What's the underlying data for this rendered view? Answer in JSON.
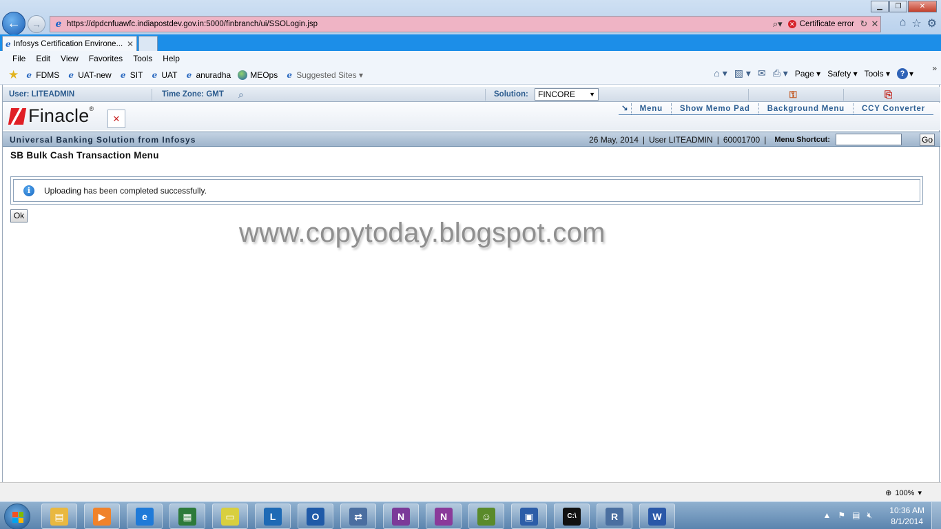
{
  "browser": {
    "url": "https://dpdcnfuawfc.indiapostdev.gov.in:5000/finbranch/ui/SSOLogin.jsp",
    "certificate_error": "Certificate error",
    "tab_title": "Infosys Certification Environe...",
    "menu": [
      "File",
      "Edit",
      "View",
      "Favorites",
      "Tools",
      "Help"
    ],
    "favorites": [
      "FDMS",
      "UAT-new",
      "SIT",
      "UAT",
      "anuradha",
      "MEOps",
      "Suggested Sites"
    ],
    "command_bar": {
      "page": "Page",
      "safety": "Safety",
      "tools": "Tools"
    },
    "zoom": "100%"
  },
  "app": {
    "user_label": "User: LITEADMIN",
    "timezone_label": "Time Zone:  GMT",
    "solution_label": "Solution:",
    "solution_value": "FINCORE",
    "logo_text": "Finacle",
    "logo_mark": "®",
    "top_menu": [
      "Menu",
      "Show Memo Pad",
      "Background Menu",
      "CCY Converter"
    ],
    "banner_title": "Universal Banking Solution from Infosys",
    "banner_date": "26 May, 2014",
    "banner_user": "User  LITEADMIN",
    "banner_sol": "60001700",
    "menu_shortcut_label": "Menu Shortcut:",
    "go_label": "Go",
    "page_heading": "SB Bulk Cash Transaction Menu",
    "message": "Uploading has been completed successfully.",
    "ok_label": "Ok"
  },
  "watermark": "www.copytoday.blogspot.com",
  "taskbar": {
    "clock_time": "10:36 AM",
    "clock_date": "8/1/2014",
    "apps": [
      {
        "name": "explorer",
        "color": "#e9b840",
        "glyph": "▤"
      },
      {
        "name": "media-player",
        "color": "#f0822a",
        "glyph": "▶"
      },
      {
        "name": "internet-explorer",
        "color": "#1f7ad8",
        "glyph": "e"
      },
      {
        "name": "system-monitor",
        "color": "#2d7a3a",
        "glyph": "▦"
      },
      {
        "name": "sticky-notes",
        "color": "#d8cf3f",
        "glyph": "▭"
      },
      {
        "name": "lync",
        "color": "#1e6ab5",
        "glyph": "L"
      },
      {
        "name": "outlook",
        "color": "#1f5aa8",
        "glyph": "O"
      },
      {
        "name": "network-tool",
        "color": "#4a6ea0",
        "glyph": "⇄"
      },
      {
        "name": "onenote",
        "color": "#7b3a99",
        "glyph": "N"
      },
      {
        "name": "onenote-clipper",
        "color": "#8a3a9a",
        "glyph": "N"
      },
      {
        "name": "frog-app",
        "color": "#5a8a2a",
        "glyph": "☺"
      },
      {
        "name": "remote-desktop",
        "color": "#2c5da8",
        "glyph": "▣"
      },
      {
        "name": "command-prompt",
        "color": "#111111",
        "glyph": "C:\\"
      },
      {
        "name": "r-app",
        "color": "#4a6fa0",
        "glyph": "R"
      },
      {
        "name": "word",
        "color": "#2a58a8",
        "glyph": "W"
      }
    ]
  },
  "colors": {
    "address_error_bg": "#efb4c5",
    "tab_strip": "#1c8ee8",
    "finacle_red": "#e01f25",
    "app_accent": "#2d5f93"
  }
}
